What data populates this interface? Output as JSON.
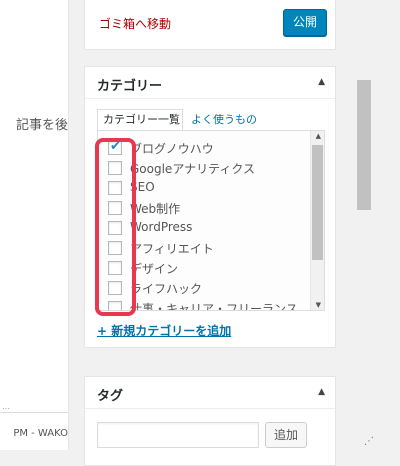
{
  "left": {
    "fragment_text": "記事を後",
    "footer_text": "PM - WAKO"
  },
  "publish": {
    "trash_label": "ゴミ箱へ移動",
    "publish_label": "公開"
  },
  "categories": {
    "title": "カテゴリー",
    "tab_all": "カテゴリー一覧",
    "tab_popular": "よく使うもの",
    "items": [
      {
        "label": "ブログノウハウ",
        "checked": true
      },
      {
        "label": "Googleアナリティクス",
        "checked": false
      },
      {
        "label": "SEO",
        "checked": false
      },
      {
        "label": "Web制作",
        "checked": false
      },
      {
        "label": "WordPress",
        "checked": false
      },
      {
        "label": "アフィリエイト",
        "checked": false
      },
      {
        "label": "デザイン",
        "checked": false
      },
      {
        "label": "ライフハック",
        "checked": false
      },
      {
        "label": "仕事・キャリア・フリーランス",
        "checked": false
      }
    ],
    "add_link": "+ 新規カテゴリーを追加"
  },
  "tags": {
    "title": "タグ",
    "add_label": "追加",
    "input_value": ""
  },
  "colors": {
    "highlight": "#e8384f",
    "primary": "#0085ba",
    "link": "#0073aa",
    "danger": "#a00"
  }
}
